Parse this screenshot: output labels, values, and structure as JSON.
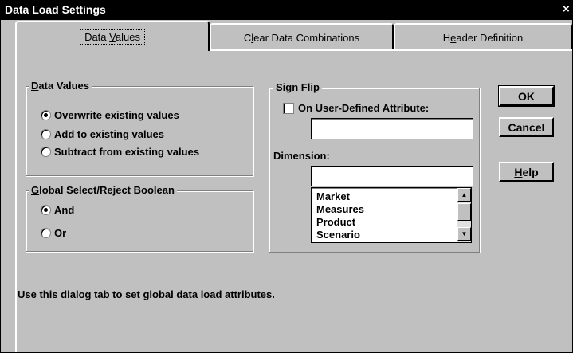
{
  "window": {
    "title": "Data Load Settings",
    "close_glyph": "×"
  },
  "tabs": [
    {
      "label_pre": "Data ",
      "label_u": "V",
      "label_post": "alues",
      "active": true
    },
    {
      "label_pre": "C",
      "label_u": "l",
      "label_post": "ear Data Combinations",
      "active": false
    },
    {
      "label_pre": "H",
      "label_u": "e",
      "label_post": "ader Definition",
      "active": false
    }
  ],
  "data_values_group": {
    "legend_u": "D",
    "legend_rest": "ata Values",
    "options": [
      {
        "label": "Overwrite existing values",
        "selected": true
      },
      {
        "label": "Add to existing values",
        "selected": false
      },
      {
        "label": "Subtract from existing values",
        "selected": false
      }
    ]
  },
  "boolean_group": {
    "legend_u": "G",
    "legend_rest": "lobal Select/Reject Boolean",
    "options": [
      {
        "label": "And",
        "selected": true
      },
      {
        "label": "Or",
        "selected": false
      }
    ]
  },
  "sign_flip_group": {
    "legend_u": "S",
    "legend_rest": "ign Flip",
    "checkbox_label": "On User-Defined Attribute:",
    "checkbox_checked": false,
    "attribute_value": "",
    "dimension_label": "Dimension:",
    "dimension_value": "",
    "dimension_list": [
      "Market",
      "Measures",
      "Product",
      "Scenario"
    ]
  },
  "buttons": {
    "ok": "OK",
    "cancel": "Cancel",
    "help_u": "H",
    "help_rest": "elp"
  },
  "status_text": "Use this dialog tab to set global data load attributes.",
  "icons": {
    "scroll_up": "▲",
    "scroll_down": "▼"
  }
}
